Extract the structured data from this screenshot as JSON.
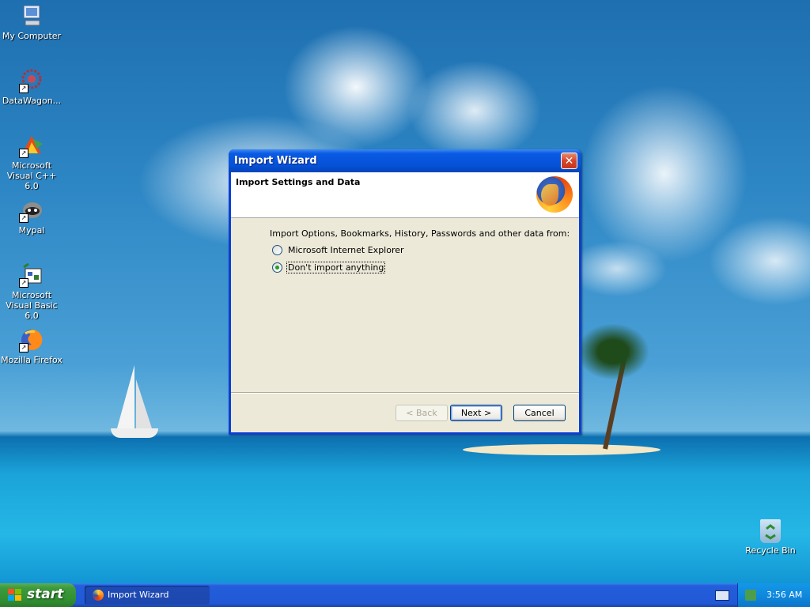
{
  "desktop": {
    "icons": [
      {
        "label": "My Computer",
        "icon": "my-computer-icon"
      },
      {
        "label": "DataWagon...",
        "icon": "datawagon-icon"
      },
      {
        "label": "Microsoft Visual C++ 6.0",
        "icon": "visual-cpp-icon"
      },
      {
        "label": "Mypal",
        "icon": "mypal-icon"
      },
      {
        "label": "Microsoft Visual Basic 6.0",
        "icon": "visual-basic-icon"
      },
      {
        "label": "Mozilla Firefox",
        "icon": "firefox-icon"
      },
      {
        "label": "Recycle Bin",
        "icon": "recycle-bin-icon"
      }
    ]
  },
  "dialog": {
    "title": "Import Wizard",
    "close_glyph": "✕",
    "header_title": "Import Settings and Data",
    "prompt": "Import Options, Bookmarks, History, Passwords and other data from:",
    "options": [
      {
        "label": "Microsoft Internet Explorer",
        "checked": false
      },
      {
        "label": "Don't import anything",
        "checked": true
      }
    ],
    "buttons": {
      "back": "< Back",
      "next": "Next >",
      "cancel": "Cancel"
    }
  },
  "taskbar": {
    "start_label": "start",
    "task_item": "Import Wizard",
    "clock": "3:56 AM"
  },
  "colors": {
    "titlebar": "#0552d8",
    "taskbar": "#245edb",
    "start_button": "#3c9b3c",
    "dialog_face": "#ece9d8"
  }
}
